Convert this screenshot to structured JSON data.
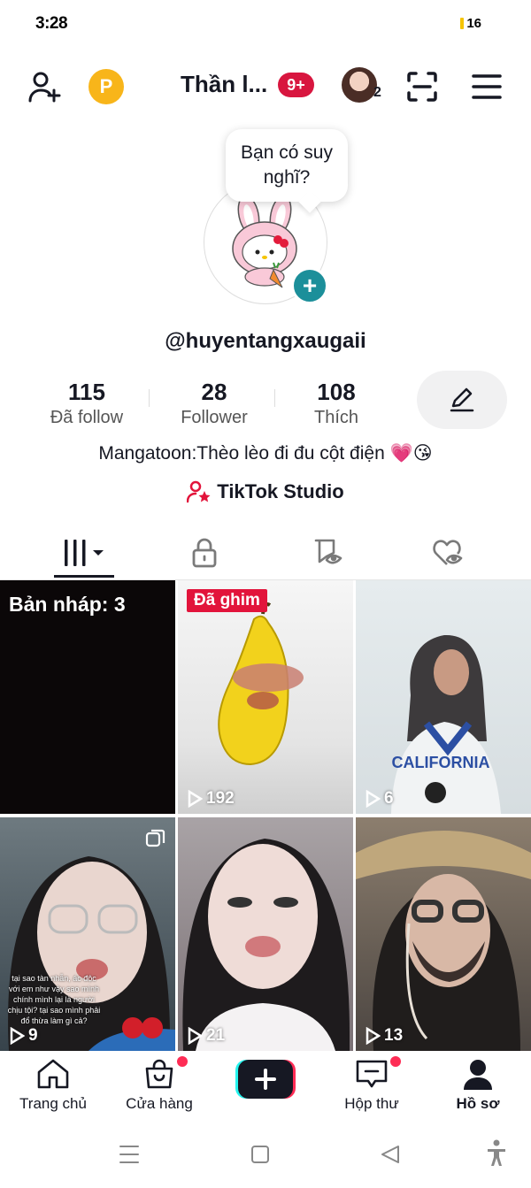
{
  "status_bar": {
    "time": "3:28",
    "battery": "16"
  },
  "header": {
    "title": "Thần l...",
    "notif_badge": "9+",
    "story_count": "2",
    "coin_letter": "P"
  },
  "profile": {
    "bubble_text": "Bạn có suy nghĩ?",
    "username": "@huyentangxaugaii",
    "bio": "Mangatoon:Thèo lèo đi đu cột điện 💗😘",
    "studio_label": "TikTok Studio"
  },
  "stats": [
    {
      "value": "115",
      "label": "Đã follow"
    },
    {
      "value": "28",
      "label": "Follower"
    },
    {
      "value": "108",
      "label": "Thích"
    }
  ],
  "grid": {
    "draft_label": "Bản nháp: 3",
    "pinned_label": "Đã ghim",
    "overlay_text": "tại sao tàn nhẫn, ác độc với em như vậy sao mình chính mình lại là người chịu tội? tại sao mình phải đổ thừa làm gì cả?",
    "items": [
      {
        "plays": "192"
      },
      {
        "plays": "6"
      },
      {
        "plays": "9"
      },
      {
        "plays": "21"
      },
      {
        "plays": "13"
      }
    ]
  },
  "bottom_nav": {
    "home": "Trang chủ",
    "shop": "Cửa hàng",
    "inbox": "Hộp thư",
    "profile": "Hồ sơ"
  },
  "colors": {
    "accent_red": "#fe2c55",
    "badge_red": "#d8163f",
    "teal": "#1c8f9a",
    "coin": "#f8b51a"
  }
}
